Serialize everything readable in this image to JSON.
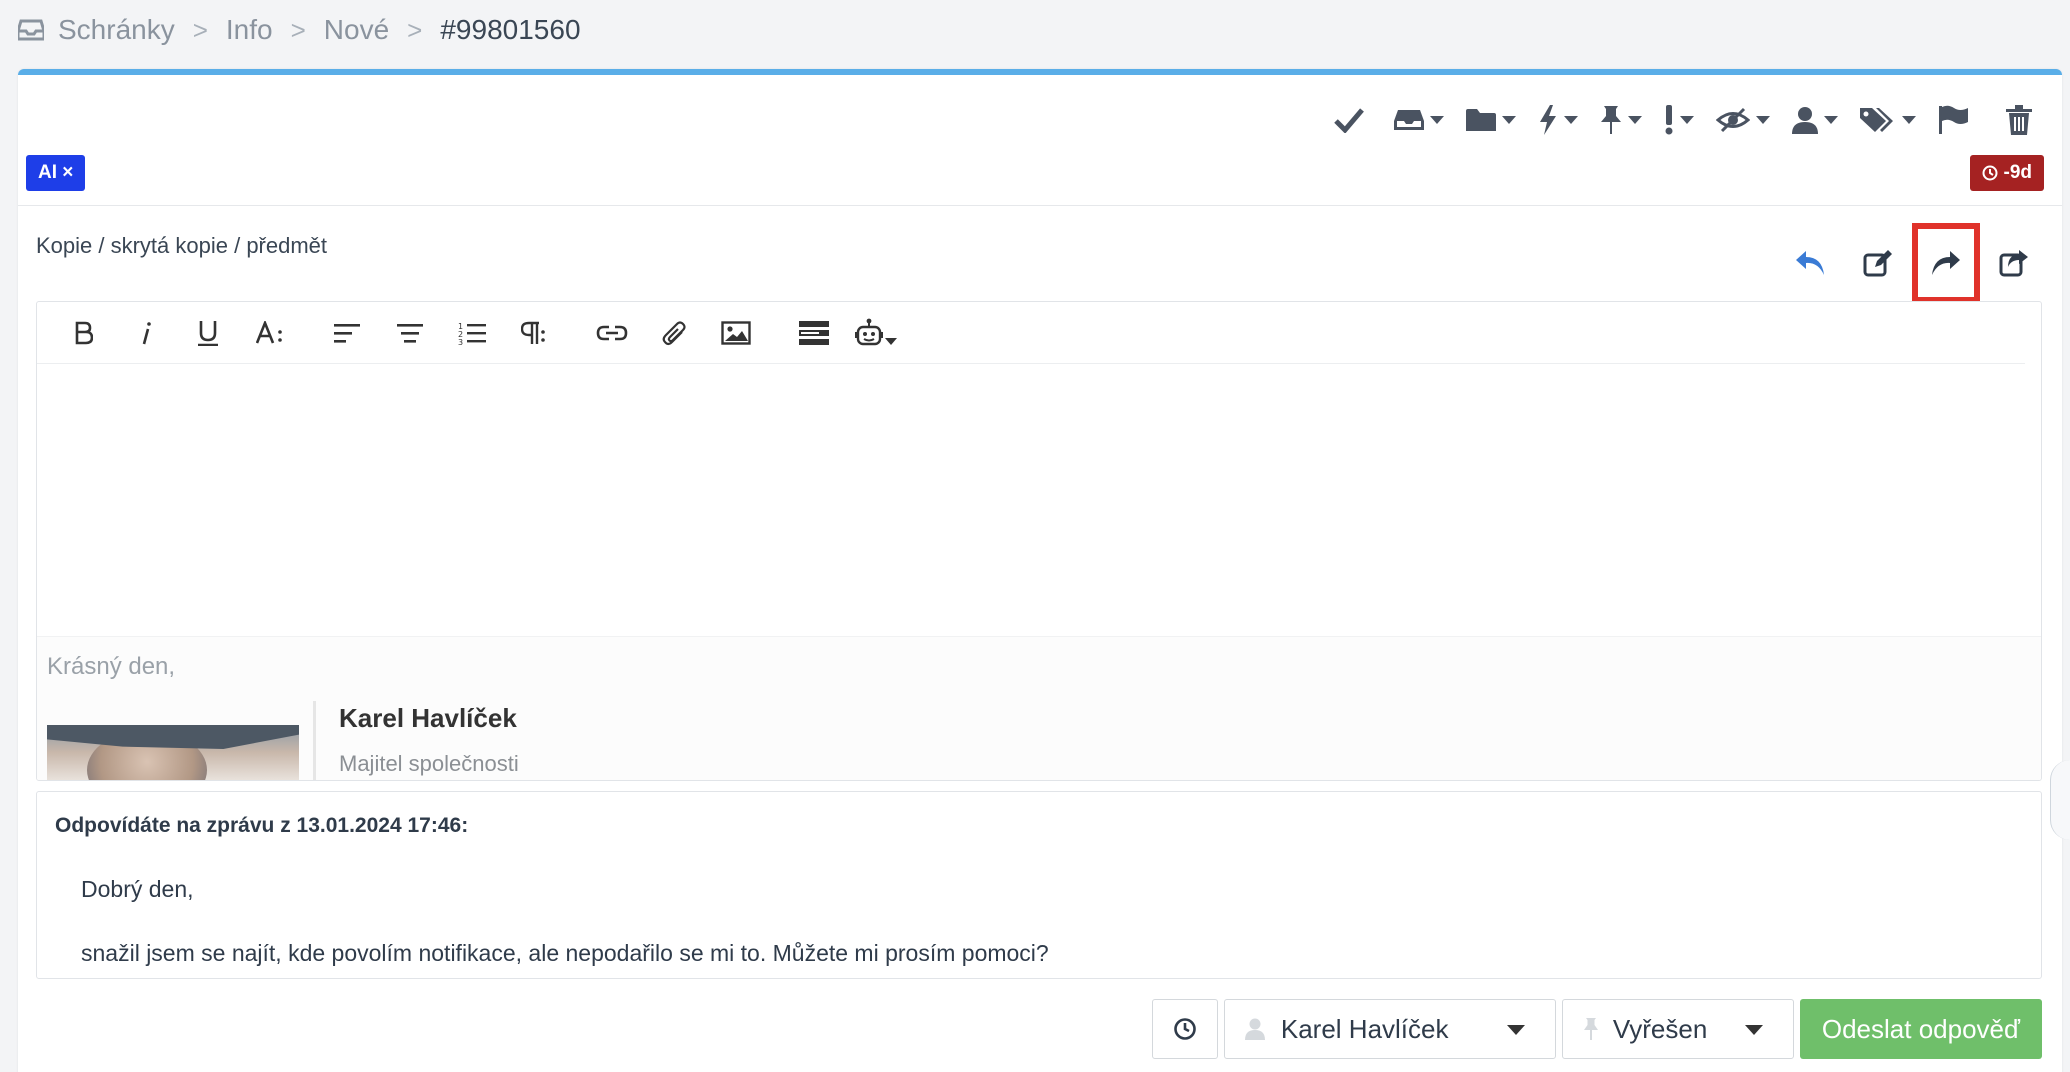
{
  "breadcrumb": {
    "items": [
      "Schránky",
      "Info",
      "Nové"
    ],
    "current": "#99801560",
    "separator": ">"
  },
  "toolbar": {
    "icons": [
      "check-icon",
      "inbox-icon",
      "folder-icon",
      "bolt-icon",
      "pin-icon",
      "exclamation-icon",
      "eye-slash-icon",
      "user-icon",
      "tags-icon",
      "flag-icon",
      "trash-icon"
    ]
  },
  "badges": {
    "ai": "AI ×",
    "overdue": "-9d"
  },
  "compose": {
    "cc_link": "Kopie / skrytá kopie / předmět",
    "reply_actions": [
      "reply-icon",
      "edit-icon",
      "forward-icon",
      "share-icon"
    ],
    "highlighted_action": "forward-icon"
  },
  "signature": {
    "greeting": "Krásný den,",
    "name": "Karel Havlíček",
    "role": "Majitel společnosti"
  },
  "quote": {
    "header": "Odpovídáte na zprávu z 13.01.2024 17:46:",
    "line1": "Dobrý den,",
    "line2": "snažil jsem se najít, kde povolím notifikace, ale nepodařilo se mi to. Můžete mi prosím pomoci?"
  },
  "footer": {
    "assignee": "Karel Havlíček",
    "status": "Vyřešen",
    "send_label": "Odeslat odpověď"
  },
  "colors": {
    "accent": "#5aaee8",
    "ai_badge": "#1e3ee8",
    "overdue_badge": "#a52222",
    "send_button": "#6fbf6a",
    "highlight": "#e0322a",
    "reply_blue": "#3a7bd5"
  }
}
